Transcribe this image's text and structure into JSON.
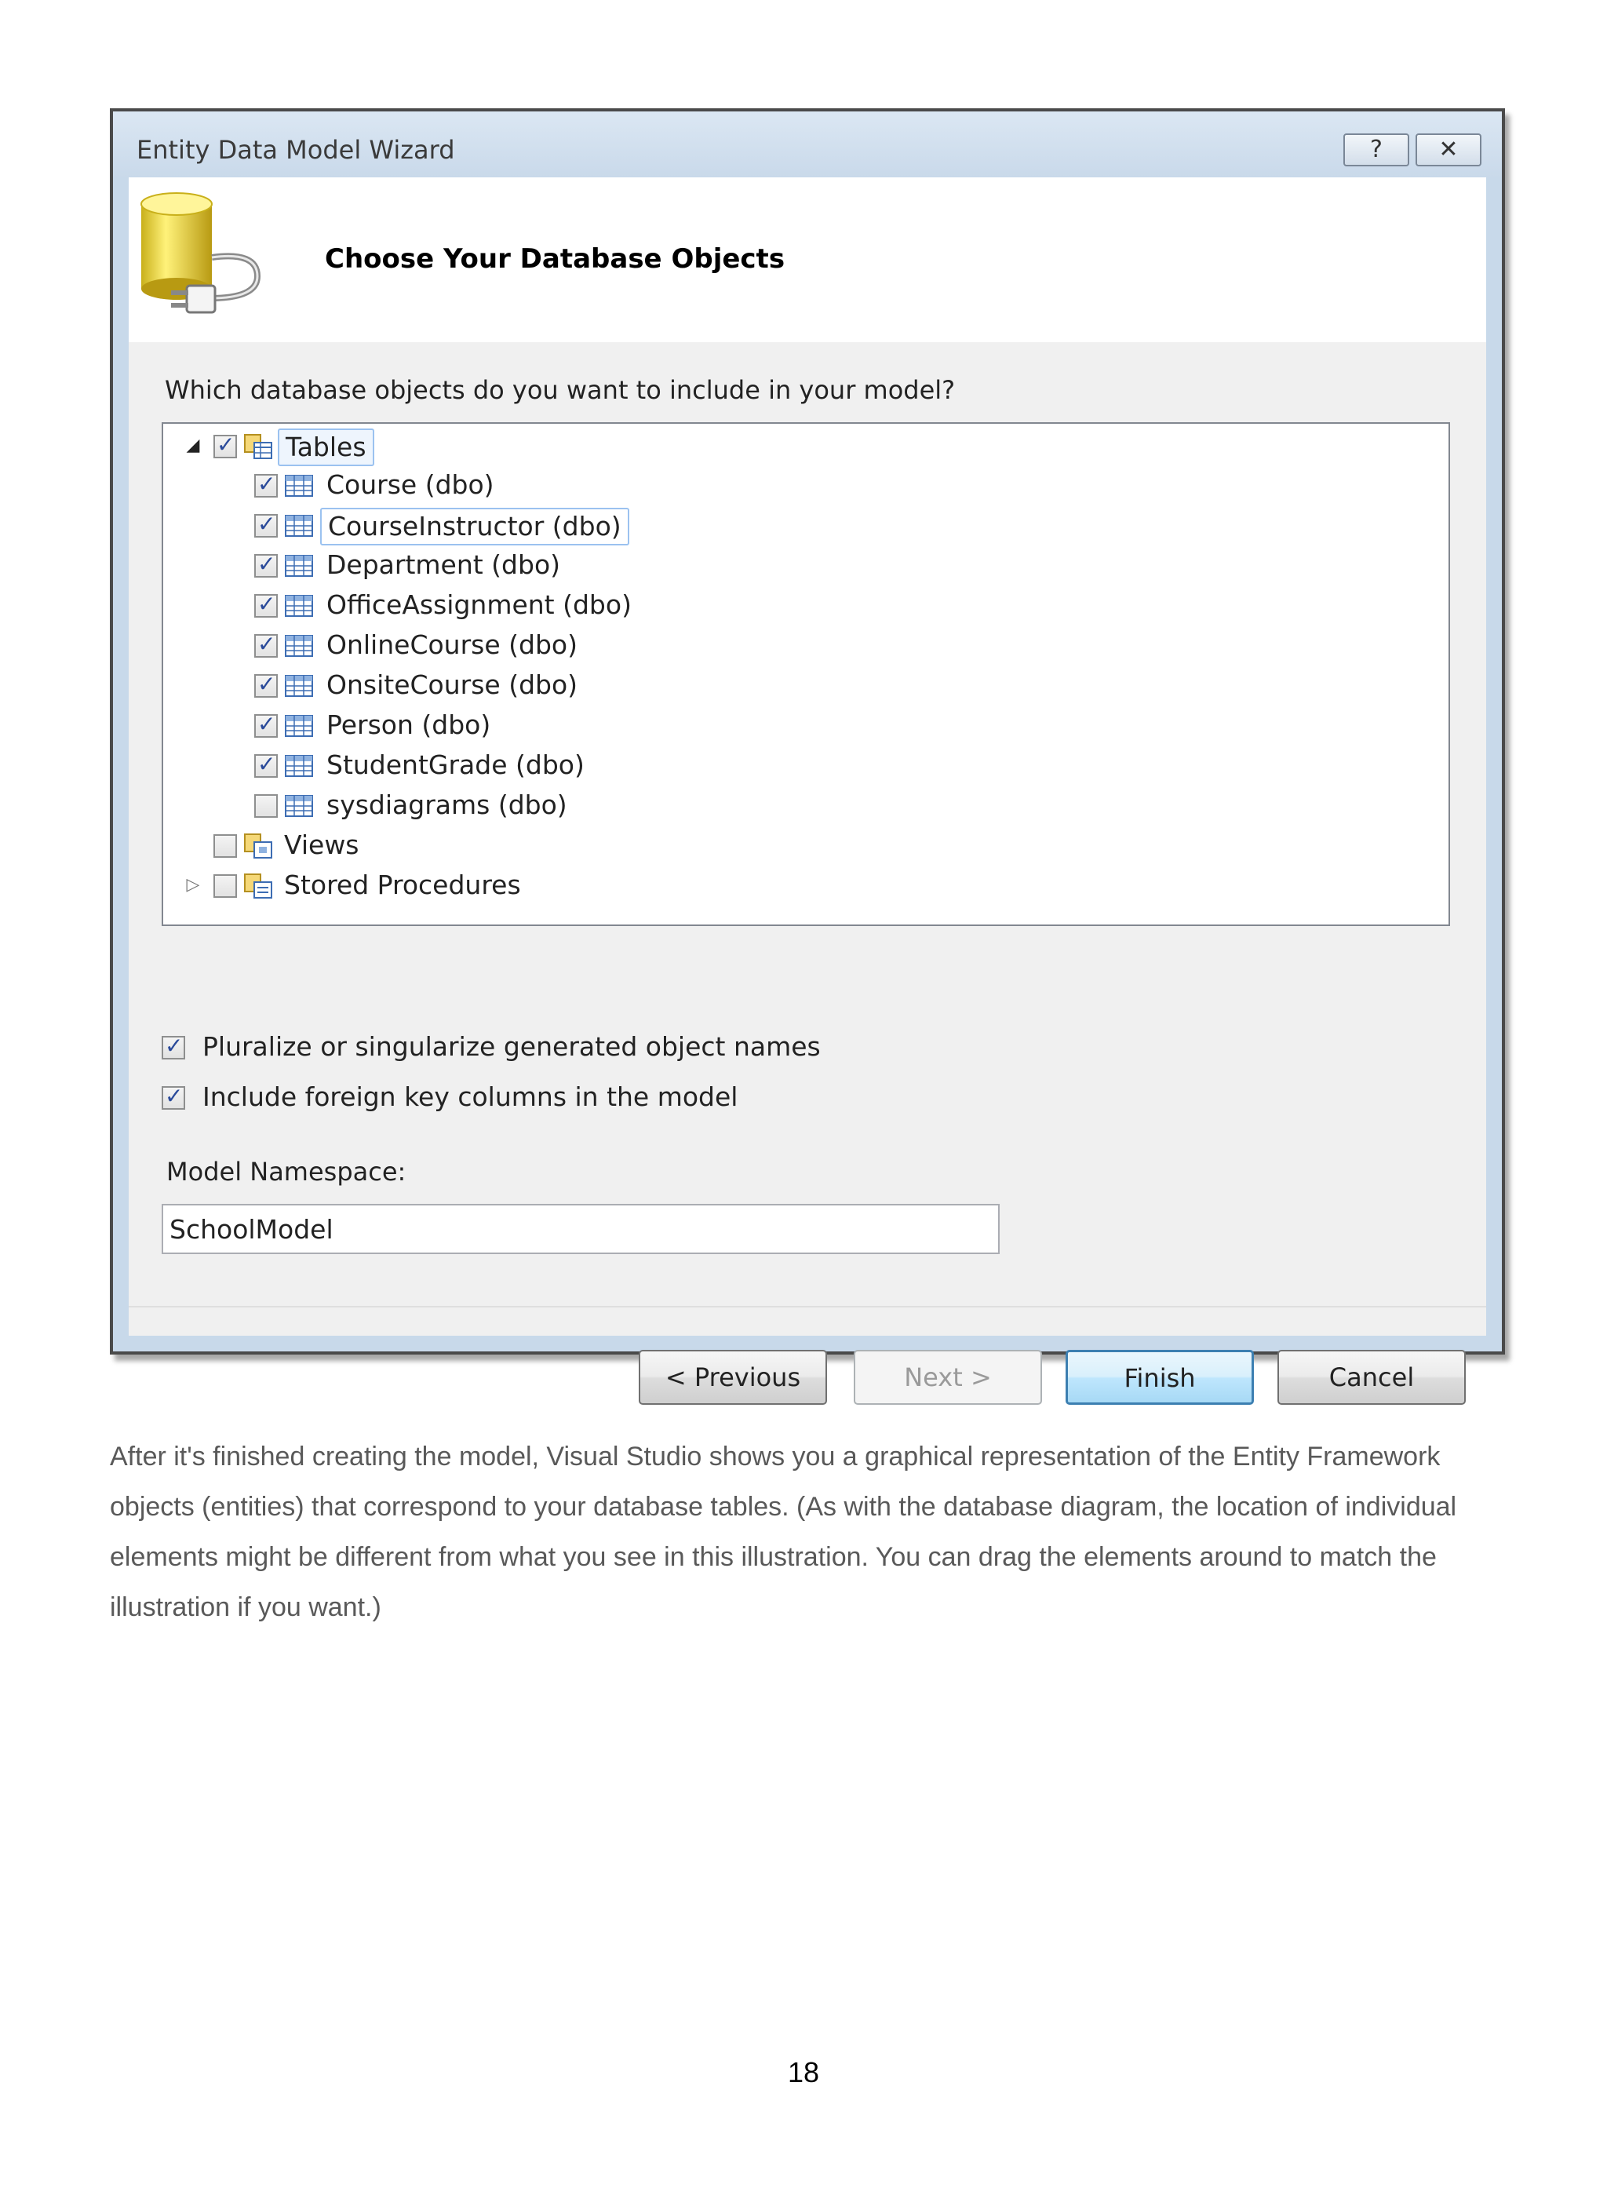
{
  "window": {
    "title": "Entity Data Model Wizard",
    "help_glyph": "?",
    "close_glyph": "✕"
  },
  "header": {
    "title": "Choose Your Database Objects",
    "icon": "database-plug-icon"
  },
  "prompt": "Which database objects do you want to include in your model?",
  "tree": {
    "tables": {
      "label": "Tables",
      "checked": true,
      "expanded": true,
      "items": [
        {
          "label": "Course (dbo)",
          "checked": true
        },
        {
          "label": "CourseInstructor (dbo)",
          "checked": true
        },
        {
          "label": "Department (dbo)",
          "checked": true
        },
        {
          "label": "OfficeAssignment (dbo)",
          "checked": true
        },
        {
          "label": "OnlineCourse (dbo)",
          "checked": true
        },
        {
          "label": "OnsiteCourse (dbo)",
          "checked": true
        },
        {
          "label": "Person (dbo)",
          "checked": true
        },
        {
          "label": "StudentGrade (dbo)",
          "checked": true
        },
        {
          "label": "sysdiagrams (dbo)",
          "checked": false
        }
      ]
    },
    "views": {
      "label": "Views",
      "checked": false
    },
    "stored_procedures": {
      "label": "Stored Procedures",
      "checked": false
    }
  },
  "options": {
    "pluralize": {
      "label": "Pluralize or singularize generated object names",
      "checked": true
    },
    "foreign_keys": {
      "label": "Include foreign key columns in the model",
      "checked": true
    }
  },
  "namespace": {
    "label": "Model Namespace:",
    "value": "SchoolModel"
  },
  "buttons": {
    "previous": "< Previous",
    "next": "Next >",
    "finish": "Finish",
    "cancel": "Cancel"
  },
  "paragraph": "After it's finished creating the model, Visual Studio shows you a graphical representation of the Entity Framework objects (entities) that correspond to your database tables. (As with the database diagram, the location of individual elements might be different from what you see in this illustration. You can drag the elements around to match the illustration if you want.)",
  "page_number": "18"
}
